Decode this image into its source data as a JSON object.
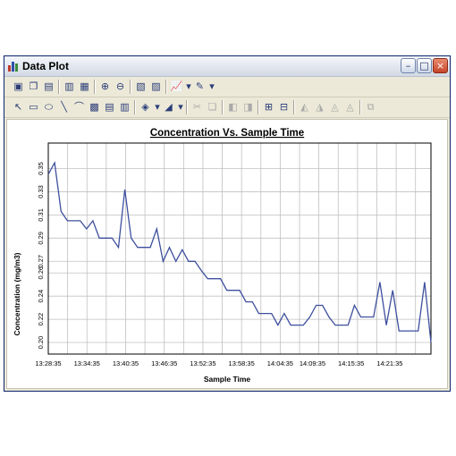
{
  "window": {
    "title": "Data Plot",
    "min_glyph": "–",
    "max_glyph": "□",
    "close_glyph": "×"
  },
  "toolbar1": {
    "icons": [
      {
        "name": "save-icon",
        "glyph": "▣"
      },
      {
        "name": "copy-icon",
        "glyph": "❐"
      },
      {
        "name": "format-icon",
        "glyph": "▤"
      },
      {
        "name": "print-preview-icon",
        "glyph": "▥"
      },
      {
        "name": "print-icon",
        "glyph": "▦"
      },
      {
        "name": "zoom-in-icon",
        "glyph": "⊕"
      },
      {
        "name": "zoom-out-icon",
        "glyph": "⊖"
      },
      {
        "name": "page-setup-icon",
        "glyph": "▧"
      },
      {
        "name": "data-sheet-icon",
        "glyph": "▨"
      },
      {
        "name": "chart-type-icon",
        "glyph": "📈"
      },
      {
        "name": "chart-type-dropdown-icon",
        "glyph": "▾"
      },
      {
        "name": "color-palette-icon",
        "glyph": "✎"
      },
      {
        "name": "color-palette-dropdown-icon",
        "glyph": "▾"
      }
    ]
  },
  "toolbar2": {
    "icons": [
      {
        "name": "pointer-icon",
        "glyph": "↖"
      },
      {
        "name": "rectangle-icon",
        "glyph": "▭"
      },
      {
        "name": "ellipse-icon",
        "glyph": "⬭"
      },
      {
        "name": "line-icon",
        "glyph": "╲"
      },
      {
        "name": "arc-icon",
        "glyph": "⌒"
      },
      {
        "name": "image-icon",
        "glyph": "▩"
      },
      {
        "name": "text-box-icon",
        "glyph": "▤"
      },
      {
        "name": "note-icon",
        "glyph": "▥"
      },
      {
        "name": "fill-color-icon",
        "glyph": "◈"
      },
      {
        "name": "fill-color-dropdown-icon",
        "glyph": "▾"
      },
      {
        "name": "line-color-icon",
        "glyph": "◢"
      },
      {
        "name": "line-color-dropdown-icon",
        "glyph": "▾"
      },
      {
        "name": "cut-icon",
        "glyph": "✂"
      },
      {
        "name": "paste-icon",
        "glyph": "❏"
      },
      {
        "name": "bring-front-icon",
        "glyph": "◧"
      },
      {
        "name": "send-back-icon",
        "glyph": "◨"
      },
      {
        "name": "group-icon",
        "glyph": "⊞"
      },
      {
        "name": "ungroup-icon",
        "glyph": "⊟"
      },
      {
        "name": "align-left-icon",
        "glyph": "◭"
      },
      {
        "name": "align-center-icon",
        "glyph": "◮"
      },
      {
        "name": "align-right-icon",
        "glyph": "◬"
      },
      {
        "name": "align-top-icon",
        "glyph": "◬"
      },
      {
        "name": "properties-icon",
        "glyph": "⧉"
      }
    ]
  },
  "colors": {
    "series_line": "#3d4f9e",
    "grid": "#c0c0c0",
    "frame": "#000000"
  },
  "chart_data": {
    "type": "line",
    "title": "Concentration Vs. Sample Time",
    "xlabel": "Sample Time",
    "ylabel": "Concentration (mg/m3)",
    "x_ticks": [
      "13:28:35",
      "13:34:35",
      "13:40:35",
      "13:46:35",
      "13:52:35",
      "13:58:35",
      "14:04:35",
      "14:09:35",
      "14:15:35",
      "14:21:35"
    ],
    "y_ticks": [
      0.2,
      0.22,
      0.24,
      0.26,
      0.27,
      0.29,
      0.31,
      0.33,
      0.35
    ],
    "y_tick_labels": [
      "0.20",
      "0.22",
      "0.24",
      "0.26",
      "0.27",
      "0.29",
      "0.31",
      "0.33",
      "0.35"
    ],
    "ylim": [
      0.19,
      0.372
    ],
    "x_range_minutes": [
      0,
      59.4
    ],
    "series": [
      {
        "values": [
          0.345,
          0.355,
          0.313,
          0.305,
          0.305,
          0.305,
          0.298,
          0.305,
          0.29,
          0.29,
          0.29,
          0.282,
          0.332,
          0.29,
          0.282,
          0.282,
          0.282,
          0.298,
          0.27,
          0.282,
          0.27,
          0.28,
          0.27,
          0.27,
          0.262,
          0.255,
          0.255,
          0.255,
          0.245,
          0.245,
          0.245,
          0.235,
          0.235,
          0.225,
          0.225,
          0.225,
          0.215,
          0.225,
          0.215,
          0.215,
          0.215,
          0.222,
          0.232,
          0.232,
          0.222,
          0.215,
          0.215,
          0.215,
          0.232,
          0.222,
          0.222,
          0.222,
          0.252,
          0.215,
          0.245,
          0.21,
          0.21,
          0.21,
          0.21,
          0.252,
          0.2
        ]
      }
    ],
    "grid": true,
    "legend": "none"
  }
}
